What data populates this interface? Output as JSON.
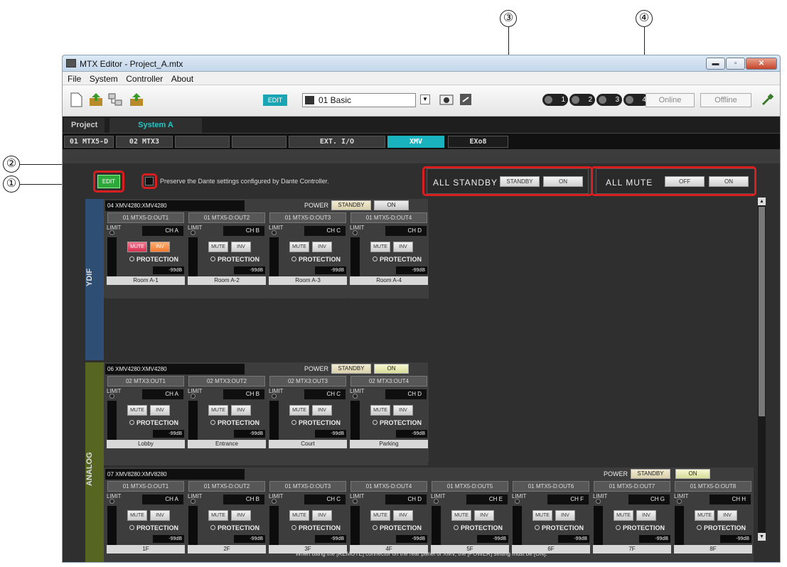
{
  "callouts": [
    "①",
    "②",
    "③",
    "④"
  ],
  "window": {
    "title": "MTX Editor - Project_A.mtx"
  },
  "window_buttons": {
    "min": "▬",
    "max": "▫",
    "close": "✕"
  },
  "menu": [
    "File",
    "System",
    "Controller",
    "About"
  ],
  "toolbar": {
    "edit_chip": "EDIT",
    "scene": "01 Basic",
    "dropdown": "▼",
    "pills": [
      "1",
      "2",
      "3",
      "4"
    ],
    "online": "Online",
    "offline": "Offline"
  },
  "tabs": {
    "project": "Project",
    "system": "System A"
  },
  "units": [
    {
      "label": "01 MTX5-D",
      "active": false
    },
    {
      "label": "02 MTX3",
      "active": false
    },
    {
      "label": "",
      "active": false
    },
    {
      "label": "",
      "active": false
    },
    {
      "label": "EXT. I/O",
      "active": false
    },
    {
      "label": "XMV",
      "active": true
    },
    {
      "label": "EXo8",
      "active": false
    }
  ],
  "controls": {
    "edit": "EDIT",
    "preserve": "Preserve the Dante settings configured by Dante Controller.",
    "all_standby": "ALL STANDBY",
    "standby_btn": "STANDBY",
    "on_btn": "ON",
    "all_mute": "ALL MUTE",
    "off_btn": "OFF"
  },
  "sections": {
    "ydif": "YDIF",
    "analog": "ANALOG"
  },
  "common": {
    "power": "POWER",
    "standby": "STANDBY",
    "on": "ON",
    "limit": "LIMIT",
    "mute": "MUTE",
    "inv": "INV",
    "protection": "PROTECTION",
    "db": "-99dB"
  },
  "devices": [
    {
      "name": "04 XMV4280:XMV4280",
      "power_on": false,
      "channels": [
        {
          "src": "01 MTX5-D:OUT1",
          "ch": "CH A",
          "label": "Room A-1",
          "mute": true,
          "inv": true
        },
        {
          "src": "01 MTX5-D:OUT2",
          "ch": "CH B",
          "label": "Room A-2",
          "mute": false,
          "inv": false
        },
        {
          "src": "01 MTX5-D:OUT3",
          "ch": "CH C",
          "label": "Room A-3",
          "mute": false,
          "inv": false
        },
        {
          "src": "01 MTX5-D:OUT4",
          "ch": "CH D",
          "label": "Room A-4",
          "mute": false,
          "inv": false
        }
      ]
    },
    {
      "name": "06 XMV4280:XMV4280",
      "power_on": true,
      "channels": [
        {
          "src": "02 MTX3:OUT1",
          "ch": "CH A",
          "label": "Lobby",
          "mute": false,
          "inv": false
        },
        {
          "src": "02 MTX3:OUT2",
          "ch": "CH B",
          "label": "Entrance",
          "mute": false,
          "inv": false
        },
        {
          "src": "02 MTX3:OUT3",
          "ch": "CH C",
          "label": "Court",
          "mute": false,
          "inv": false
        },
        {
          "src": "02 MTX3:OUT4",
          "ch": "CH D",
          "label": "Parking",
          "mute": false,
          "inv": false
        }
      ]
    },
    {
      "name": "07 XMV8280:XMV8280",
      "power_on": true,
      "channels": [
        {
          "src": "01 MTX5-D:OUT1",
          "ch": "CH A",
          "label": "1F",
          "mute": false,
          "inv": false
        },
        {
          "src": "01 MTX5-D:OUT2",
          "ch": "CH B",
          "label": "2F",
          "mute": false,
          "inv": false
        },
        {
          "src": "01 MTX5-D:OUT3",
          "ch": "CH C",
          "label": "3F",
          "mute": false,
          "inv": false
        },
        {
          "src": "01 MTX5-D:OUT4",
          "ch": "CH D",
          "label": "4F",
          "mute": false,
          "inv": false
        },
        {
          "src": "01 MTX5-D:OUT5",
          "ch": "CH E",
          "label": "5F",
          "mute": false,
          "inv": false
        },
        {
          "src": "01 MTX5-D:OUT6",
          "ch": "CH F",
          "label": "6F",
          "mute": false,
          "inv": false
        },
        {
          "src": "01 MTX5-D:OUT7",
          "ch": "CH G",
          "label": "7F",
          "mute": false,
          "inv": false
        },
        {
          "src": "01 MTX5-D:OUT8",
          "ch": "CH H",
          "label": "8F",
          "mute": false,
          "inv": false
        }
      ]
    }
  ],
  "note": "When using the [REMOTE] connector on the rear panel of XMV, the [POWER] setting must be [ON].",
  "colors": {
    "ydif": "#2e4e74",
    "analog": "#566620",
    "edit_green": "#2ea83a",
    "xmv_tab": "#1ab2be",
    "callout_red": "#d81e1e"
  }
}
